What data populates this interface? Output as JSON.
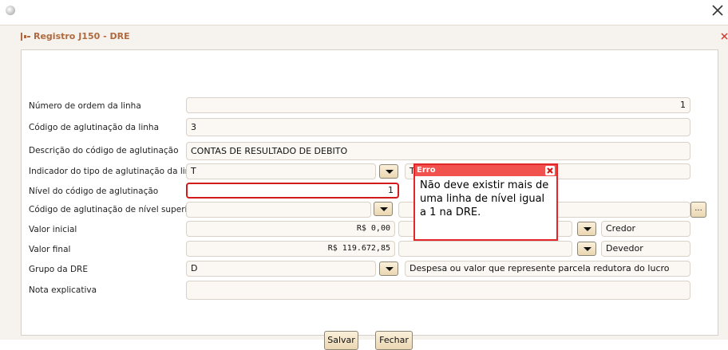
{
  "window": {
    "app_icon": "app-icon",
    "close_icon": "close-icon"
  },
  "panel": {
    "title": "Registro J150 - DRE",
    "title_icon": "form-icon",
    "close_icon": "close-icon",
    "title_color": "#b06a3f"
  },
  "form": {
    "numero_ordem": {
      "label": "Número de ordem da linha",
      "value": "1"
    },
    "codigo_aglutinacao": {
      "label": "Código de aglutinação da linha",
      "value": "3"
    },
    "descricao": {
      "label": "Descrição do código de aglutinação",
      "value": "CONTAS DE RESULTADO DE DEBITO"
    },
    "indicador_tipo": {
      "label": "Indicador do tipo de aglutinação da linha",
      "value": "T",
      "description": "Totalizador"
    },
    "nivel": {
      "label": "Nível do código de aglutinação",
      "value": "1"
    },
    "codigo_superior": {
      "label": "Código de aglutinação de nível superior",
      "value": "",
      "button_label": "..."
    },
    "valor_inicial": {
      "label": "Valor inicial",
      "value": "R$ 0,00",
      "indicator": "",
      "indicator_description": "Credor"
    },
    "valor_final": {
      "label": "Valor final",
      "value": "R$ 119.672,85",
      "indicator": "",
      "indicator_description": "Devedor"
    },
    "grupo_dre": {
      "label": "Grupo da DRE",
      "value": "D",
      "description": "Despesa ou valor que represente parcela redutora do lucro"
    },
    "nota_explicativa": {
      "label": "Nota explicativa",
      "value": ""
    }
  },
  "buttons": {
    "save": "Salvar",
    "close": "Fechar"
  },
  "error_tooltip": {
    "title": "Erro",
    "message": "Não deve existir mais de uma linha de nível igual a 1 na DRE.",
    "border_color": "#e2262a",
    "header_color": "#f2524e"
  }
}
